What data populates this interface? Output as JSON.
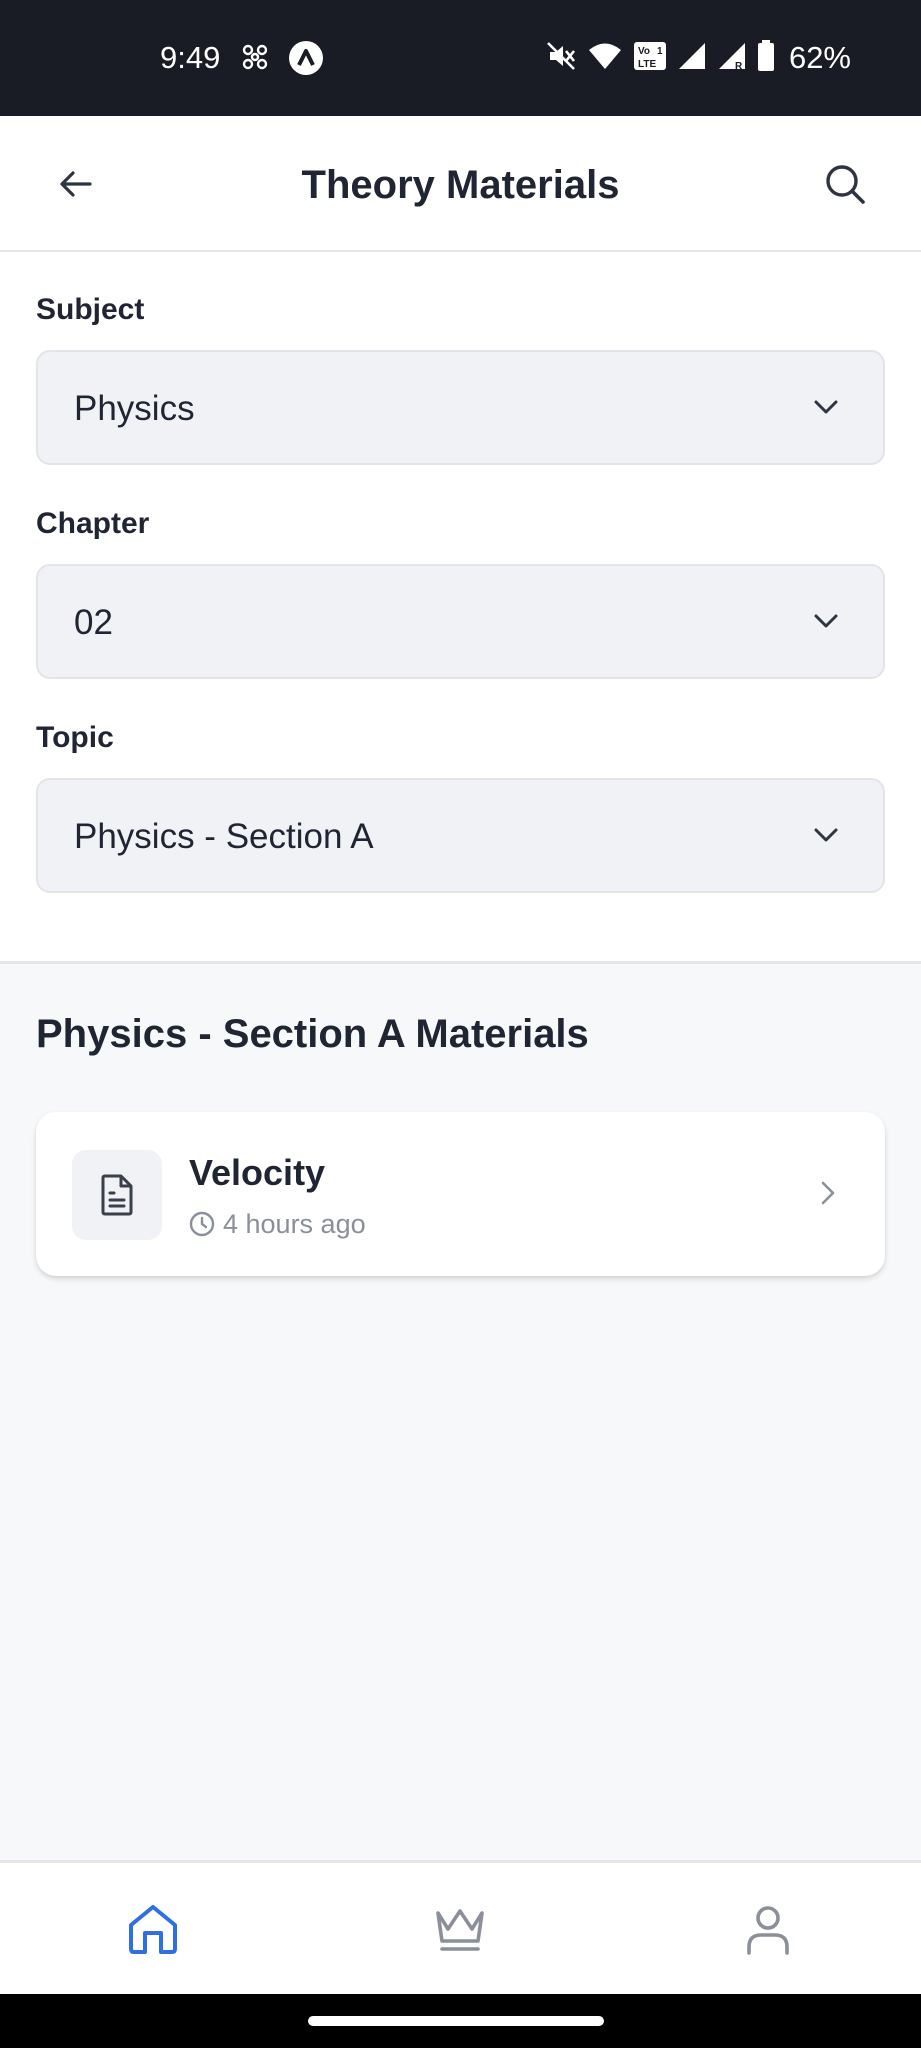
{
  "status_bar": {
    "time": "9:49",
    "battery_percent": "62%",
    "icons": [
      "fan-icon",
      "app-a-icon",
      "mute-icon",
      "wifi-icon",
      "volte-icon",
      "signal-icon",
      "signal-roaming-icon",
      "battery-icon"
    ]
  },
  "app_bar": {
    "title": "Theory Materials",
    "back_icon": "arrow-left-icon",
    "search_icon": "search-icon"
  },
  "filters": {
    "subject": {
      "label": "Subject",
      "value": "Physics"
    },
    "chapter": {
      "label": "Chapter",
      "value": "02"
    },
    "topic": {
      "label": "Topic",
      "value": "Physics - Section A"
    }
  },
  "materials": {
    "heading": "Physics - Section A Materials",
    "items": [
      {
        "title": "Velocity",
        "time": "4 hours ago",
        "icon": "document-icon"
      }
    ]
  },
  "bottom_nav": {
    "items": [
      {
        "name": "home",
        "icon": "home-icon",
        "active": true
      },
      {
        "name": "premium",
        "icon": "crown-icon",
        "active": false
      },
      {
        "name": "profile",
        "icon": "user-icon",
        "active": false
      }
    ],
    "active_color": "#2f6fe4",
    "inactive_color": "#8a8f9a"
  }
}
